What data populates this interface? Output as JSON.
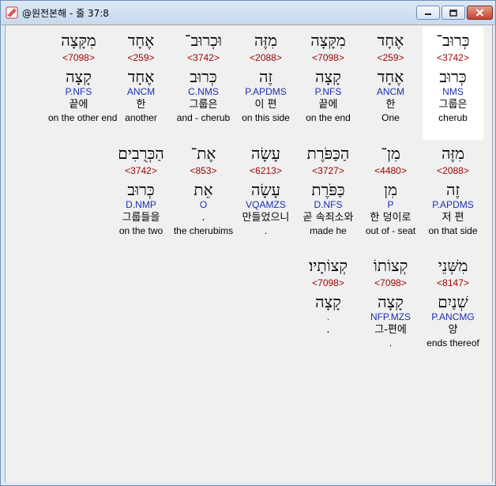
{
  "window": {
    "title": "@원전본해 - 줄 37:8",
    "minimize_icon": "minimize-icon",
    "maximize_icon": "maximize-icon",
    "close_icon": "close-icon"
  },
  "rows": [
    [
      {
        "hebrew": "כְּרוּב־",
        "strong": "<3742>",
        "lemma": "כְּרוּב",
        "parse": "NMS",
        "korean": "그룹은",
        "english": "cherub",
        "selected": true
      },
      {
        "hebrew": "אֶחָד",
        "strong": "<259>",
        "lemma": "אֶחָד",
        "parse": "ANCM",
        "korean": "한",
        "english": "One"
      },
      {
        "hebrew": "מִקָּצָה",
        "strong": "<7098>",
        "lemma": "קָצָה",
        "parse": "P.NFS",
        "korean": "끝에",
        "english": "on the end"
      },
      {
        "hebrew": "מִזֶּה",
        "strong": "<2088>",
        "lemma": "זֶה",
        "parse": "P.APDMS",
        "korean": "이 편",
        "english": "on this side"
      },
      {
        "hebrew": "וּכְרוּב־",
        "strong": "<3742>",
        "lemma": "כְּרוּב",
        "parse": "C.NMS",
        "korean": "그룹은",
        "english": "and - cherub"
      },
      {
        "hebrew": "אֶחָד",
        "strong": "<259>",
        "lemma": "אֶחָד",
        "parse": "ANCM",
        "korean": "한",
        "english": "another"
      },
      {
        "hebrew": "מִקָּצָה",
        "strong": "<7098>",
        "lemma": "קָצָה",
        "parse": "P.NFS",
        "korean": "끝에",
        "english": "on the other end"
      }
    ],
    [
      {
        "hebrew": "מִזֶּה",
        "strong": "<2088>",
        "lemma": "זֶה",
        "parse": "P.APDMS",
        "korean": "저 편",
        "english": "on that side"
      },
      {
        "hebrew": "מִן־",
        "strong": "<4480>",
        "lemma": "מִן",
        "parse": "P",
        "korean": "한 덩이로",
        "english": "out of - seat"
      },
      {
        "hebrew": "הַכַּפֹּרֶת",
        "strong": "<3727>",
        "lemma": "כַּפֹּרֶת",
        "parse": "D.NFS",
        "korean": "곧 속죄소와",
        "english": "made he"
      },
      {
        "hebrew": "עָשָׂה",
        "strong": "<6213>",
        "lemma": "עָשָׂה",
        "parse": "VQAMZS",
        "korean": "만들었으니",
        "english": "."
      },
      {
        "hebrew": "אֶת־",
        "strong": "<853>",
        "lemma": "אֵת",
        "parse": "O",
        "korean": ".",
        "english": "the cherubims"
      },
      {
        "hebrew": "הַכְּרֻבִים",
        "strong": "<3742>",
        "lemma": "כְּרוּב",
        "parse": "D.NMP",
        "korean": "그룹들을",
        "english": "on the two"
      }
    ],
    [
      {
        "hebrew": "מִשְּׁנֵי",
        "strong": "<8147>",
        "lemma": "שְׁנַיִם",
        "parse": "P.ANCMG",
        "korean": "양",
        "english": "ends thereof"
      },
      {
        "hebrew": "קְצוֹתוֹ",
        "strong": "<7098>",
        "lemma": "קָצָה",
        "parse": "NFP.MZS",
        "korean": "그-편에",
        "english": "."
      },
      {
        "hebrew": "קְצוֹתָיו׃",
        "strong": "<7098>",
        "lemma": "קָצָה",
        "parse": ".",
        "korean": ".",
        "english": ""
      }
    ]
  ]
}
